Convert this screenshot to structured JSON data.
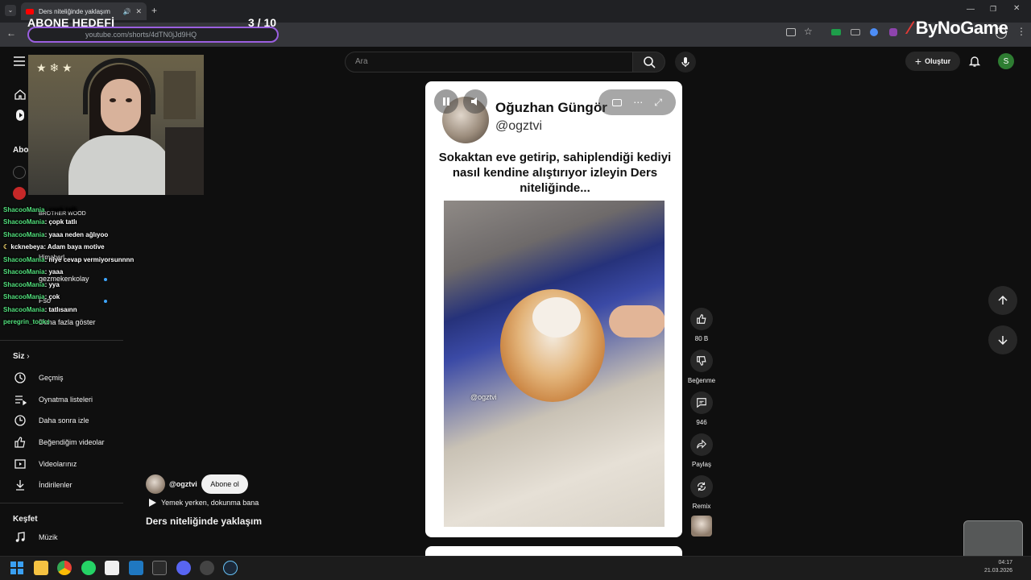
{
  "browser": {
    "tab_title": "Ders niteliğinde yaklaşım",
    "url": "youtube.com/shorts/4dTN0jJd9HQ"
  },
  "stream_overlay": {
    "goal_label": "ABONE HEDEFİ",
    "goal_count": "3  / 10",
    "brand": "ByNoGame"
  },
  "header": {
    "search_placeholder": "Ara",
    "create_label": "Oluştur",
    "avatar_letter": "S"
  },
  "sidebar": {
    "subscriptions_title": "Abo",
    "channels": [
      "BROTHER WOOD",
      "Himaherl",
      "gezmekenkolay",
      "Fso"
    ],
    "show_more": "Daha fazla göster",
    "you_title": "Siz",
    "you_items": [
      "Geçmiş",
      "Oynatma listeleri",
      "Daha sonra izle",
      "Beğendiğim videolar",
      "Videolarınız",
      "İndirilenler"
    ],
    "explore_title": "Keşfet",
    "explore_items": [
      "Müzik"
    ]
  },
  "chat": [
    {
      "user": "ShacooMania",
      "msg": ": çopk tatlı"
    },
    {
      "user": "ShacooMania",
      "msg": ": yaaa neden ağlıyoo"
    },
    {
      "user": "kcknebeya",
      "msg": ": Adam baya motive"
    },
    {
      "user": "ShacooMania",
      "msg": ": niye cevap vermiyorsunnnn"
    },
    {
      "user": "ShacooMania",
      "msg": ": yaaa"
    },
    {
      "user": "ShacooMania",
      "msg": ": yya"
    },
    {
      "user": "ShacooMania",
      "msg": ": çok"
    },
    {
      "user": "ShacooMania",
      "msg": ": tatlısaınn"
    },
    {
      "user": "peregrin_tooks",
      "msg": ""
    }
  ],
  "short": {
    "author_name": "Oğuzhan Güngör",
    "author_handle": "@ogztvi",
    "caption": "Sokaktan eve getirip, sahiplendiği kediyi nasıl kendine alıştırıyor izleyin Ders niteliğinde...",
    "watermark": "@ogztvi",
    "channel_handle": "@ogztvi",
    "subscribe_label": "Abone ol",
    "music": "Yemek yerken, dokunma bana",
    "title": "Ders niteliğinde yaklaşım"
  },
  "actions": {
    "like_count": "80 B",
    "dislike_label": "Beğenme",
    "comment_count": "946",
    "share_label": "Paylaş",
    "remix_label": "Remix"
  },
  "clock": {
    "time": "04:17",
    "date": "21.03.2026"
  }
}
